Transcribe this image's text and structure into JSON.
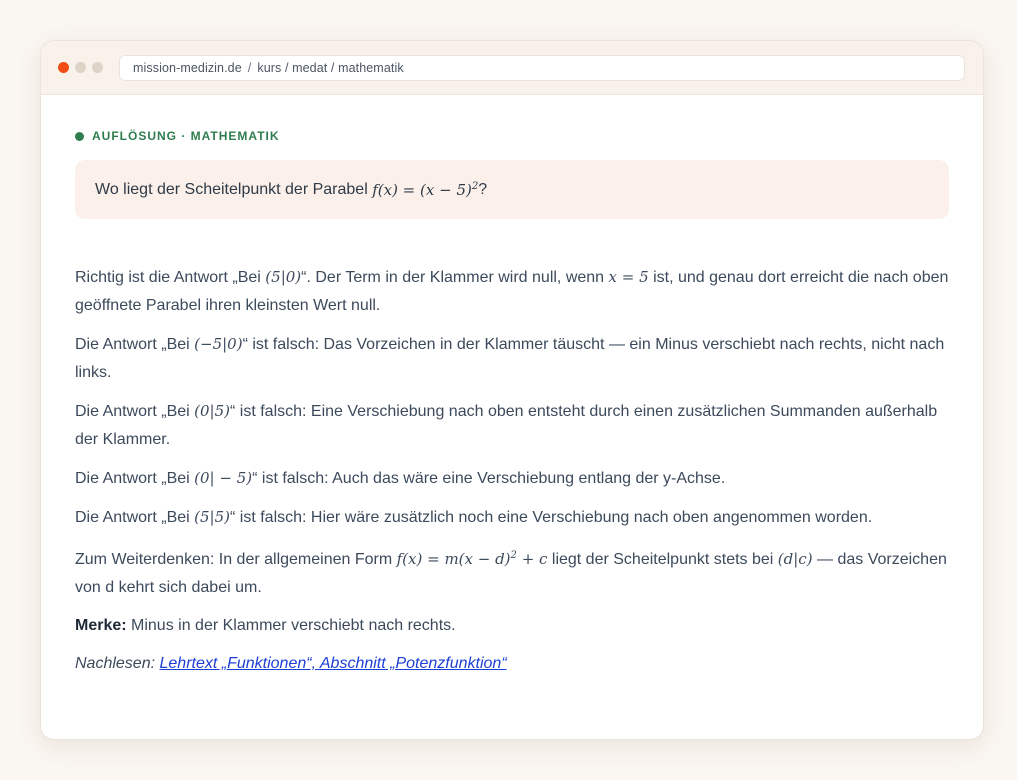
{
  "browser": {
    "traffic_light_colors": [
      "#f04e16",
      "#ddd3c7",
      "#ddd3c7"
    ],
    "url_domain": "mission-medizin.de",
    "url_path": "kurs / medat / mathematik"
  },
  "header": {
    "kicker": "AUFLÖSUNG · MATHEMATIK",
    "accent_color": "#2f7d4f"
  },
  "question": {
    "prefix": "Wo liegt der Scheitelpunkt der Parabel",
    "formula": "f(x) = (x − 5)",
    "exponent": "2",
    "suffix": "?"
  },
  "explanation": {
    "p1": {
      "a": "Richtig ist die Antwort „Bei ",
      "m1": "(5|0)",
      "b": "“. Der Term in der Klammer wird null, wenn ",
      "m2": "x = 5",
      "c": " ist, und genau dort erreicht die nach oben geöffnete Parabel ihren kleinsten Wert null."
    },
    "p2": {
      "a": "Die Antwort „Bei ",
      "m1": "(−5|0)",
      "b": "“ ist falsch: Das Vorzeichen in der Klammer täuscht — ein Minus verschiebt nach rechts, nicht nach links."
    },
    "p3": {
      "a": "Die Antwort „Bei ",
      "m1": "(0|5)",
      "b": "“ ist falsch: Eine Verschiebung nach oben entsteht durch einen zusätzlichen Summanden außerhalb der Klammer."
    },
    "p4": {
      "a": "Die Antwort „Bei ",
      "m1": "(0| − 5)",
      "b": "“ ist falsch: Auch das wäre eine Verschiebung entlang der y-Achse."
    },
    "p5": {
      "a": "Die Antwort „Bei ",
      "m1": "(5|5)",
      "b": "“ ist falsch: Hier wäre zusätzlich noch eine Verschiebung nach oben angenommen worden."
    },
    "p6": {
      "a": "Zum Weiterdenken: In der allgemeinen Form ",
      "m1": "f(x) = m(x − d)",
      "m1_exp": "2",
      "m1_tail": " + c",
      "b": " liegt der Scheitelpunkt stets bei ",
      "m2": "(d|c)",
      "c": " — das Vorzeichen von d kehrt sich dabei um."
    },
    "merke_label": "Merke:",
    "merke_text": " Minus in der Klammer verschiebt nach rechts.",
    "reading_label": "Nachlesen: ",
    "reading_link": "Lehrtext „Funktionen“, Abschnitt „Potenzfunktion“"
  }
}
